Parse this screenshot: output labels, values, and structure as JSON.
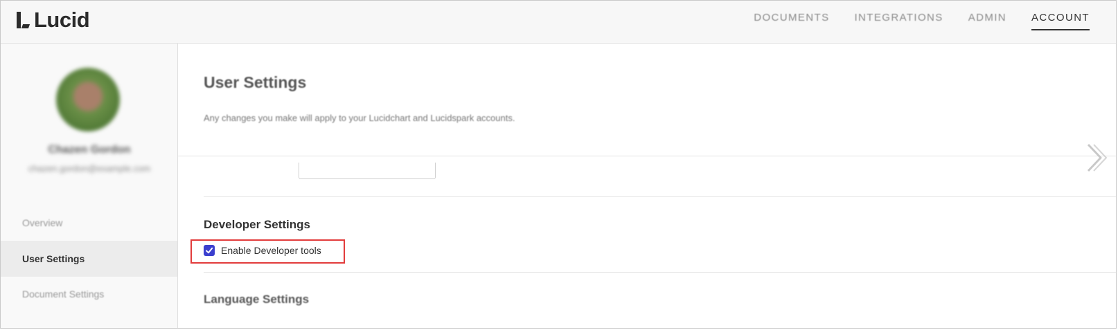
{
  "app": {
    "logo_text": "Lucid"
  },
  "topnav": {
    "items": [
      {
        "label": "DOCUMENTS"
      },
      {
        "label": "INTEGRATIONS"
      },
      {
        "label": "ADMIN"
      },
      {
        "label": "ACCOUNT",
        "active": true
      }
    ]
  },
  "sidebar": {
    "user": {
      "name": "Chazen Gordon",
      "email": "chazen.gordon@example.com"
    },
    "items": [
      {
        "label": "Overview"
      },
      {
        "label": "User Settings",
        "active": true
      },
      {
        "label": "Document Settings"
      }
    ]
  },
  "main": {
    "title": "User Settings",
    "subtitle": "Any changes you make will apply to your Lucidchart and Lucidspark accounts.",
    "developer": {
      "title": "Developer Settings",
      "checkbox_label": "Enable Developer tools",
      "checked": true
    },
    "language": {
      "title": "Language Settings"
    }
  },
  "colors": {
    "checkbox": "#3b3fce",
    "highlight": "#e23b3b"
  }
}
